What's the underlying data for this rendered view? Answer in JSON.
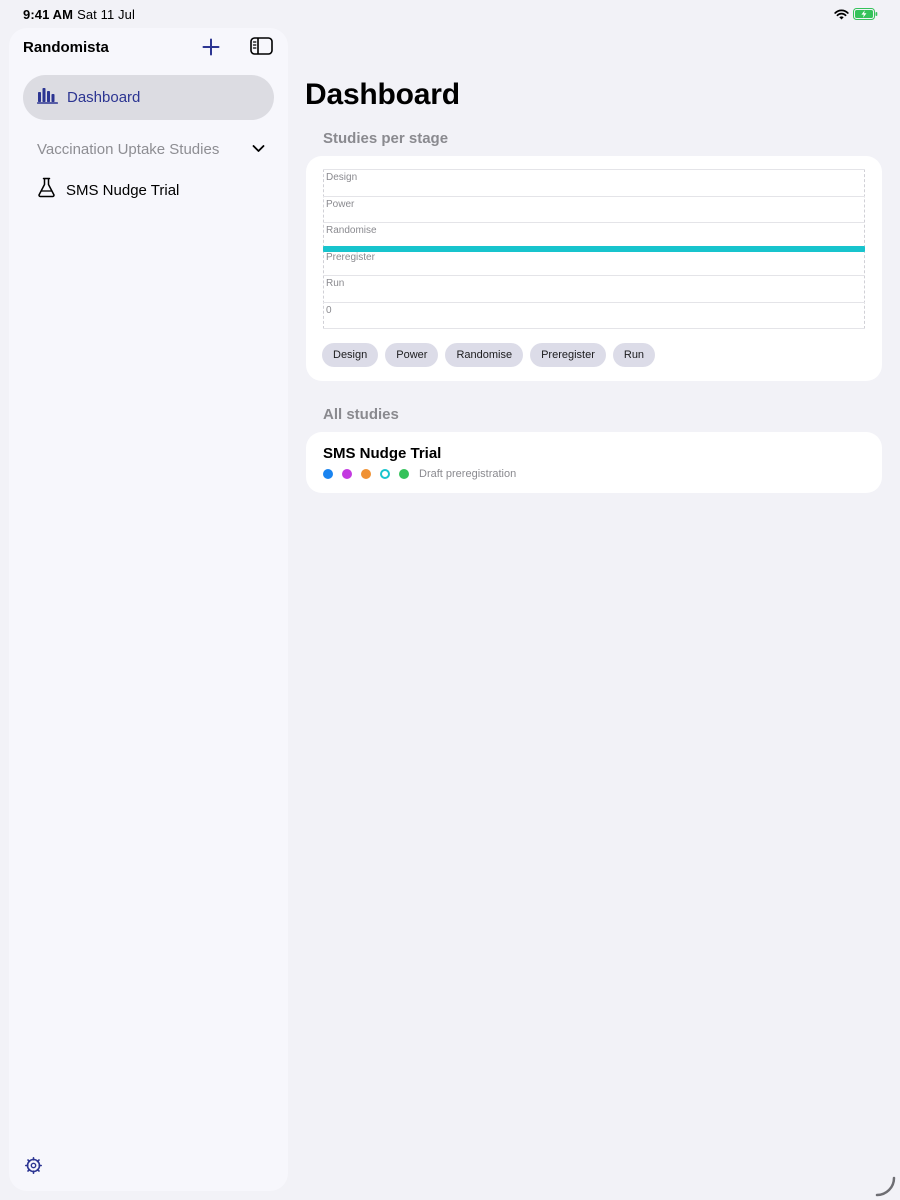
{
  "status_bar": {
    "time": "9:41 AM",
    "date": "Sat 11 Jul"
  },
  "sidebar": {
    "title": "Randomista",
    "items": [
      {
        "label": "Dashboard",
        "icon": "bar-chart-icon",
        "selected": true
      }
    ],
    "section": {
      "label": "Vaccination Uptake Studies",
      "expanded": true
    },
    "section_items": [
      {
        "label": "SMS Nudge Trial",
        "icon": "flask-icon"
      }
    ]
  },
  "main": {
    "title": "Dashboard",
    "chart_section_title": "Studies per stage",
    "studies_section_title": "All studies",
    "studies": [
      {
        "name": "SMS Nudge Trial",
        "status": "Draft preregistration",
        "stage_dots": [
          {
            "color": "#1a84f0",
            "filled": true
          },
          {
            "color": "#c33ae0",
            "filled": true
          },
          {
            "color": "#f09133",
            "filled": true
          },
          {
            "color": "#18c4cd",
            "filled": false
          },
          {
            "color": "#35c25a",
            "filled": true
          }
        ]
      }
    ]
  },
  "colors": {
    "accent": "#2c3592",
    "bar": "#18c4cd"
  },
  "chart_data": {
    "type": "bar",
    "orientation": "horizontal",
    "categories": [
      "Design",
      "Power",
      "Randomise",
      "Preregister",
      "Run"
    ],
    "values": [
      0,
      0,
      0,
      1,
      0
    ],
    "xlim": [
      0,
      1
    ],
    "x_tick_labels": [
      "0"
    ],
    "legend": [
      "Design",
      "Power",
      "Randomise",
      "Preregister",
      "Run"
    ],
    "legend_position": "bottom",
    "grid": true
  }
}
